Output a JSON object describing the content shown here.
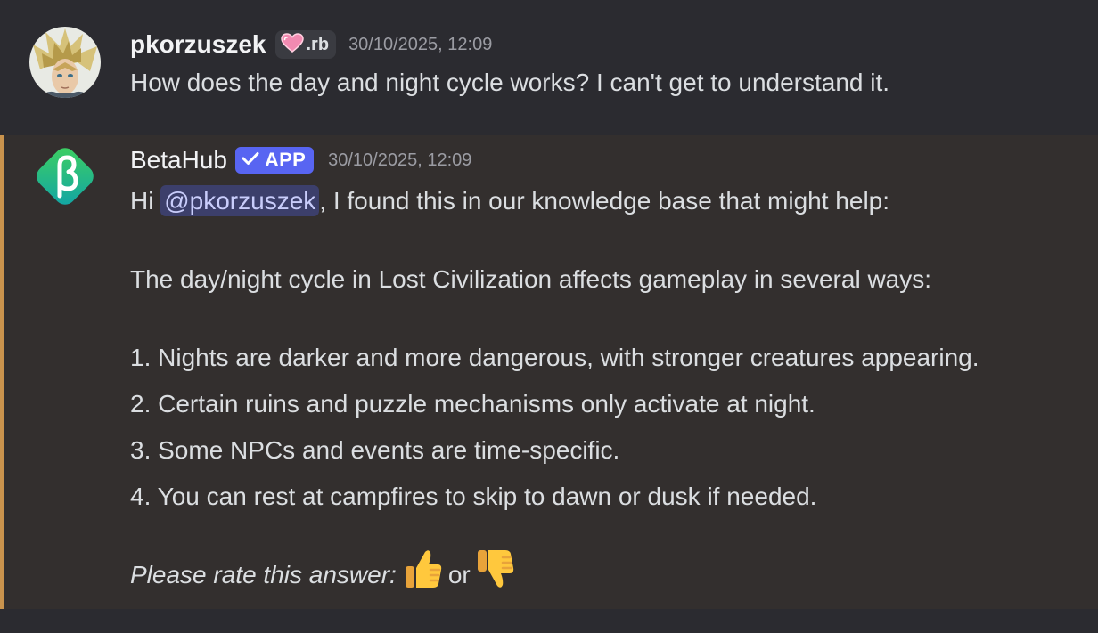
{
  "messages": [
    {
      "author": "pkorzuszek",
      "guild_tag": ".rb",
      "guild_tag_icon": "pink-heart-icon",
      "timestamp": "30/10/2025, 12:09",
      "text": "How does the day and night cycle works? I can't get to understand it."
    },
    {
      "author": "BetaHub",
      "badge": "APP",
      "timestamp": "30/10/2025, 12:09",
      "greeting_prefix": "Hi ",
      "mention": "@pkorzuszek",
      "greeting_suffix": ", I found this in our knowledge base that might help:",
      "intro": "The day/night cycle in Lost Civilization affects gameplay in several ways:",
      "list": [
        "1. Nights are darker and more dangerous, with stronger creatures appearing.",
        "2. Certain ruins and puzzle mechanisms only activate at night.",
        "3. Some NPCs and events are time-specific.",
        "4. You can rest at campfires to skip to dawn or dusk if needed."
      ],
      "rate_prompt": "Please rate this answer:",
      "rate_or": "or",
      "rate_up_icon": "thumbs-up-icon",
      "rate_down_icon": "thumbs-down-icon"
    }
  ],
  "colors": {
    "background": "#2b2b30",
    "highlight_background": "#332f2e",
    "highlight_accent": "#c9934d",
    "app_badge": "#5865f2",
    "mention_background": "#3c3f6b",
    "mention_text": "#c9cdfb",
    "timestamp": "#9b9ca3"
  }
}
